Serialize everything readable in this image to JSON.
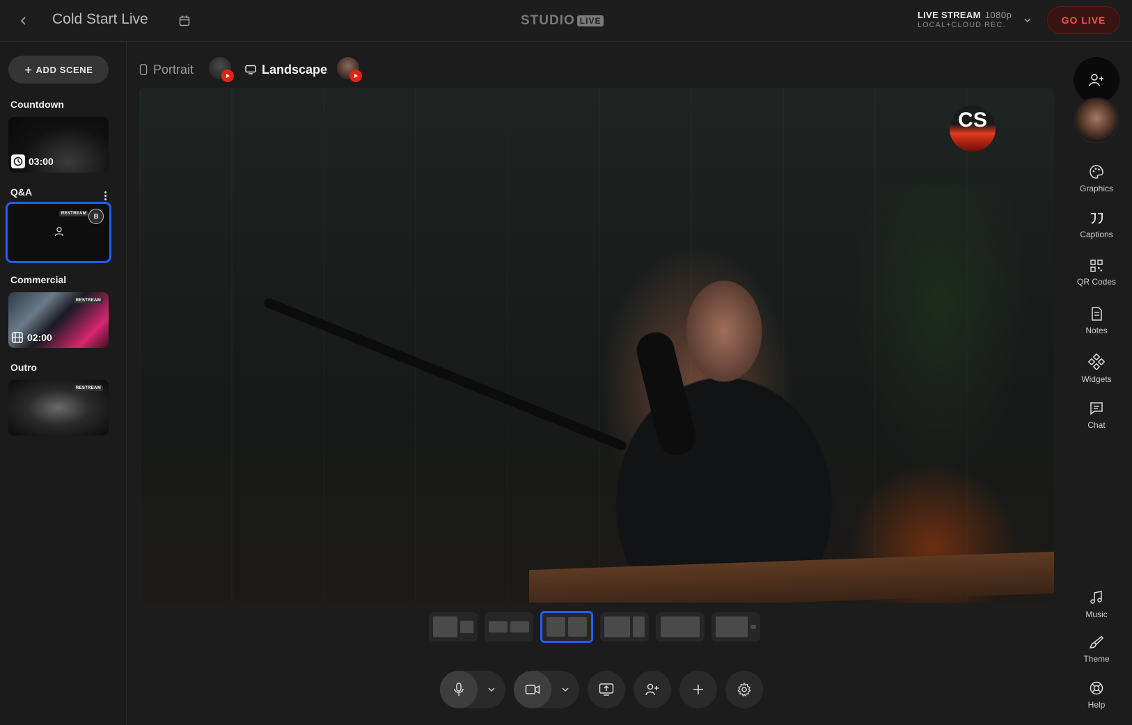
{
  "header": {
    "title": "Cold Start Live",
    "logo_word": "STUDIO",
    "logo_badge": "LIVE",
    "stream_type": "LIVE STREAM",
    "stream_resolution": "1080p",
    "stream_recording": "LOCAL+CLOUD REC.",
    "go_live_label": "GO LIVE",
    "accent_color": "#f2533f"
  },
  "sidebar": {
    "add_scene_label": "ADD SCENE",
    "scenes": [
      {
        "label": "Countdown",
        "duration": "03:00",
        "icon": "clock-icon"
      },
      {
        "label": "Q&A",
        "badge": "B",
        "tag": "RESTREAM",
        "selected": true
      },
      {
        "label": "Commercial",
        "duration": "02:00",
        "icon": "film-icon",
        "tag": "RESTREAM"
      },
      {
        "label": "Outro",
        "tag": "RESTREAM"
      }
    ]
  },
  "orientation": {
    "portrait_label": "Portrait",
    "landscape_label": "Landscape",
    "active": "Landscape"
  },
  "stage": {
    "logo_badge_text": "CS"
  },
  "layouts": {
    "count": 6,
    "active_index": 2
  },
  "controls": {
    "items": [
      "microphone-icon",
      "camera-icon",
      "screen-share-icon",
      "add-guest-icon",
      "plus-icon",
      "settings-icon"
    ]
  },
  "rail": {
    "tools": [
      {
        "label": "Graphics",
        "icon": "palette-icon"
      },
      {
        "label": "Captions",
        "icon": "quote-icon"
      },
      {
        "label": "QR Codes",
        "icon": "qr-code-icon"
      },
      {
        "label": "Notes",
        "icon": "notes-icon"
      },
      {
        "label": "Widgets",
        "icon": "widgets-icon"
      },
      {
        "label": "Chat",
        "icon": "chat-icon"
      },
      {
        "label": "Music",
        "icon": "music-icon"
      },
      {
        "label": "Theme",
        "icon": "brush-icon"
      },
      {
        "label": "Help",
        "icon": "help-icon"
      }
    ]
  }
}
